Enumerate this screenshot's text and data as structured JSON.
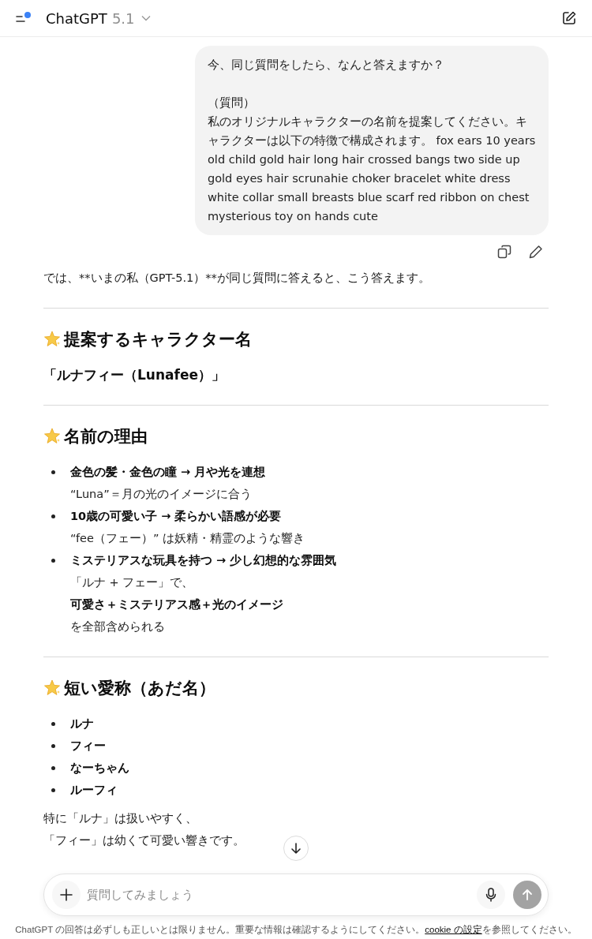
{
  "header": {
    "title": "ChatGPT",
    "version": "5.1"
  },
  "user_message": {
    "paragraphs": [
      "今、同じ質問をしたら、なんと答えますか？",
      "（質問）",
      "私のオリジナルキャラクターの名前を提案してください。キャラクターは以下の特徴で構成されます。 fox ears 10 years old child gold hair long hair crossed bangs two side up gold eyes hair scrunahie choker bracelet white dress white collar small breasts blue scarf red ribbon on chest mysterious toy on hands cute"
    ]
  },
  "blocks": [
    {
      "kind": "paragraph",
      "text": "では、**いまの私（GPT-5.1）**が同じ質問に答えると、こう答えます。"
    },
    {
      "kind": "divider"
    },
    {
      "kind": "heading",
      "text": "提案するキャラクター名"
    },
    {
      "kind": "strong",
      "text": "「ルナフィー（Lunafee）」"
    },
    {
      "kind": "divider"
    },
    {
      "kind": "heading",
      "text": "名前の理由"
    },
    {
      "kind": "bullets",
      "items": [
        {
          "title": "金色の髪・金色の瞳 → 月や光を連想",
          "lines": [
            {
              "text": "“Luna”＝月の光のイメージに合う",
              "bold": false
            }
          ]
        },
        {
          "title": "10歳の可愛い子 → 柔らかい語感が必要",
          "lines": [
            {
              "text": "“fee（フェー）” は妖精・精霊のような響き",
              "bold": false
            }
          ]
        },
        {
          "title": "ミステリアスな玩具を持つ → 少し幻想的な雰囲気",
          "lines": [
            {
              "text": "「ルナ + フェー」で、",
              "bold": false
            },
            {
              "text": "可愛さ＋ミステリアス感＋光のイメージ",
              "bold": true
            },
            {
              "text": "を全部含められる",
              "bold": false
            }
          ]
        }
      ]
    },
    {
      "kind": "divider"
    },
    {
      "kind": "heading",
      "text": "短い愛称（あだ名）"
    },
    {
      "kind": "bullets",
      "items": [
        {
          "title": "ルナ"
        },
        {
          "title": "フィー"
        },
        {
          "title": "なーちゃん"
        },
        {
          "title": "ルーフィ"
        }
      ]
    },
    {
      "kind": "paragraph",
      "text": "特に「ルナ」は扱いやすく、"
    },
    {
      "kind": "paragraph",
      "text": "「フィー」は幼くて可愛い響きです。"
    }
  ],
  "composer": {
    "placeholder": "質問してみましょう"
  },
  "footer": {
    "before": "ChatGPT の回答は必ずしも正しいとは限りません。重要な情報は確認するようにしてください。",
    "link": "cookie の設定",
    "after": "を参照してください。"
  }
}
